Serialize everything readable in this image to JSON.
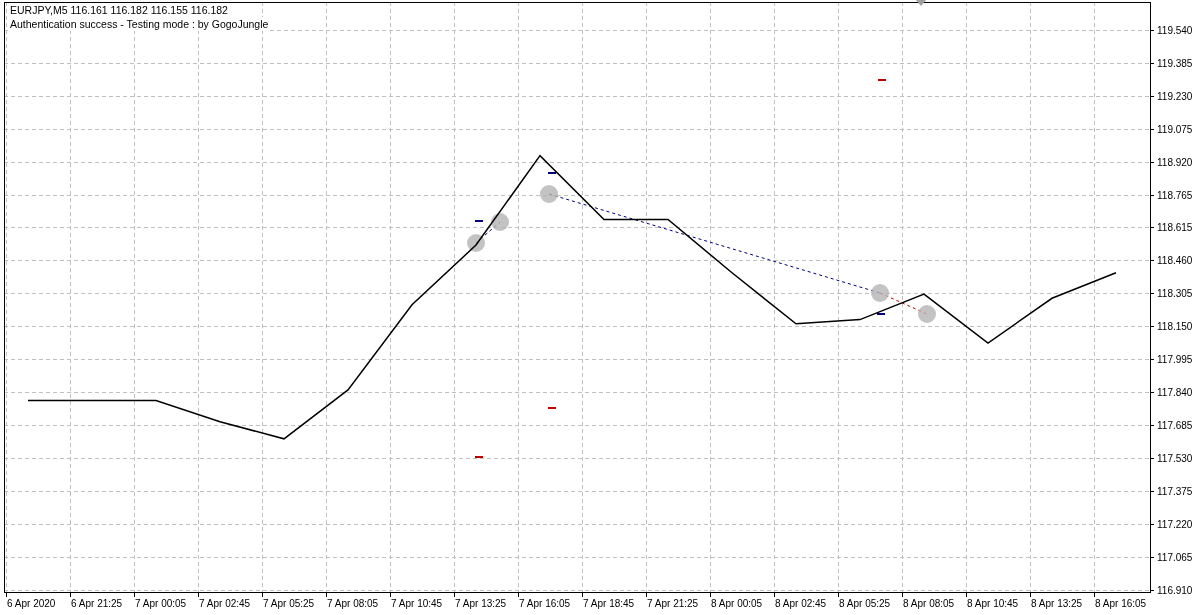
{
  "chart": {
    "symbol_line": "EURJPY,M5  116.161 116.182 116.155 116.182",
    "status_text": "Authentication success - Testing mode : by GogoJungle",
    "chart_data": {
      "type": "line",
      "grid": true,
      "categories": [
        "6 Apr 2020",
        "6 Apr 21:25",
        "7 Apr 00:05",
        "7 Apr 02:45",
        "7 Apr 05:25",
        "7 Apr 08:05",
        "7 Apr 10:45",
        "7 Apr 13:25",
        "7 Apr 16:05",
        "7 Apr 18:45",
        "7 Apr 21:25",
        "8 Apr 00:05",
        "8 Apr 02:45",
        "8 Apr 05:25",
        "8 Apr 08:05",
        "8 Apr 10:45",
        "8 Apr 13:25",
        "8 Apr 16:05"
      ],
      "series": [
        {
          "color": "#000000",
          "values": [
            117.8,
            117.8,
            117.8,
            117.7,
            117.62,
            117.85,
            118.25,
            118.53,
            118.95,
            118.65,
            118.65,
            118.4,
            118.16,
            118.18,
            118.3,
            118.07,
            118.28,
            118.4
          ]
        }
      ],
      "ylim": [
        116.91,
        119.54
      ],
      "yticks": [
        {
          "value": 119.54,
          "label": "119.540"
        },
        {
          "value": 119.385,
          "label": "119.385"
        },
        {
          "value": 119.23,
          "label": "119.230"
        },
        {
          "value": 119.075,
          "label": "119.075"
        },
        {
          "value": 118.92,
          "label": "118.920"
        },
        {
          "value": 118.765,
          "label": "118.765"
        },
        {
          "value": 118.615,
          "label": "118.615"
        },
        {
          "value": 118.46,
          "label": "118.460"
        },
        {
          "value": 118.305,
          "label": "118.305"
        },
        {
          "value": 118.15,
          "label": "118.150"
        },
        {
          "value": 117.995,
          "label": "117.995"
        },
        {
          "value": 117.84,
          "label": "117.840"
        },
        {
          "value": 117.685,
          "label": "117.685"
        },
        {
          "value": 117.53,
          "label": "117.530"
        },
        {
          "value": 117.375,
          "label": "117.375"
        },
        {
          "value": 117.22,
          "label": "117.220"
        },
        {
          "value": 117.065,
          "label": "117.065"
        },
        {
          "value": 116.91,
          "label": "116.910"
        }
      ]
    }
  }
}
